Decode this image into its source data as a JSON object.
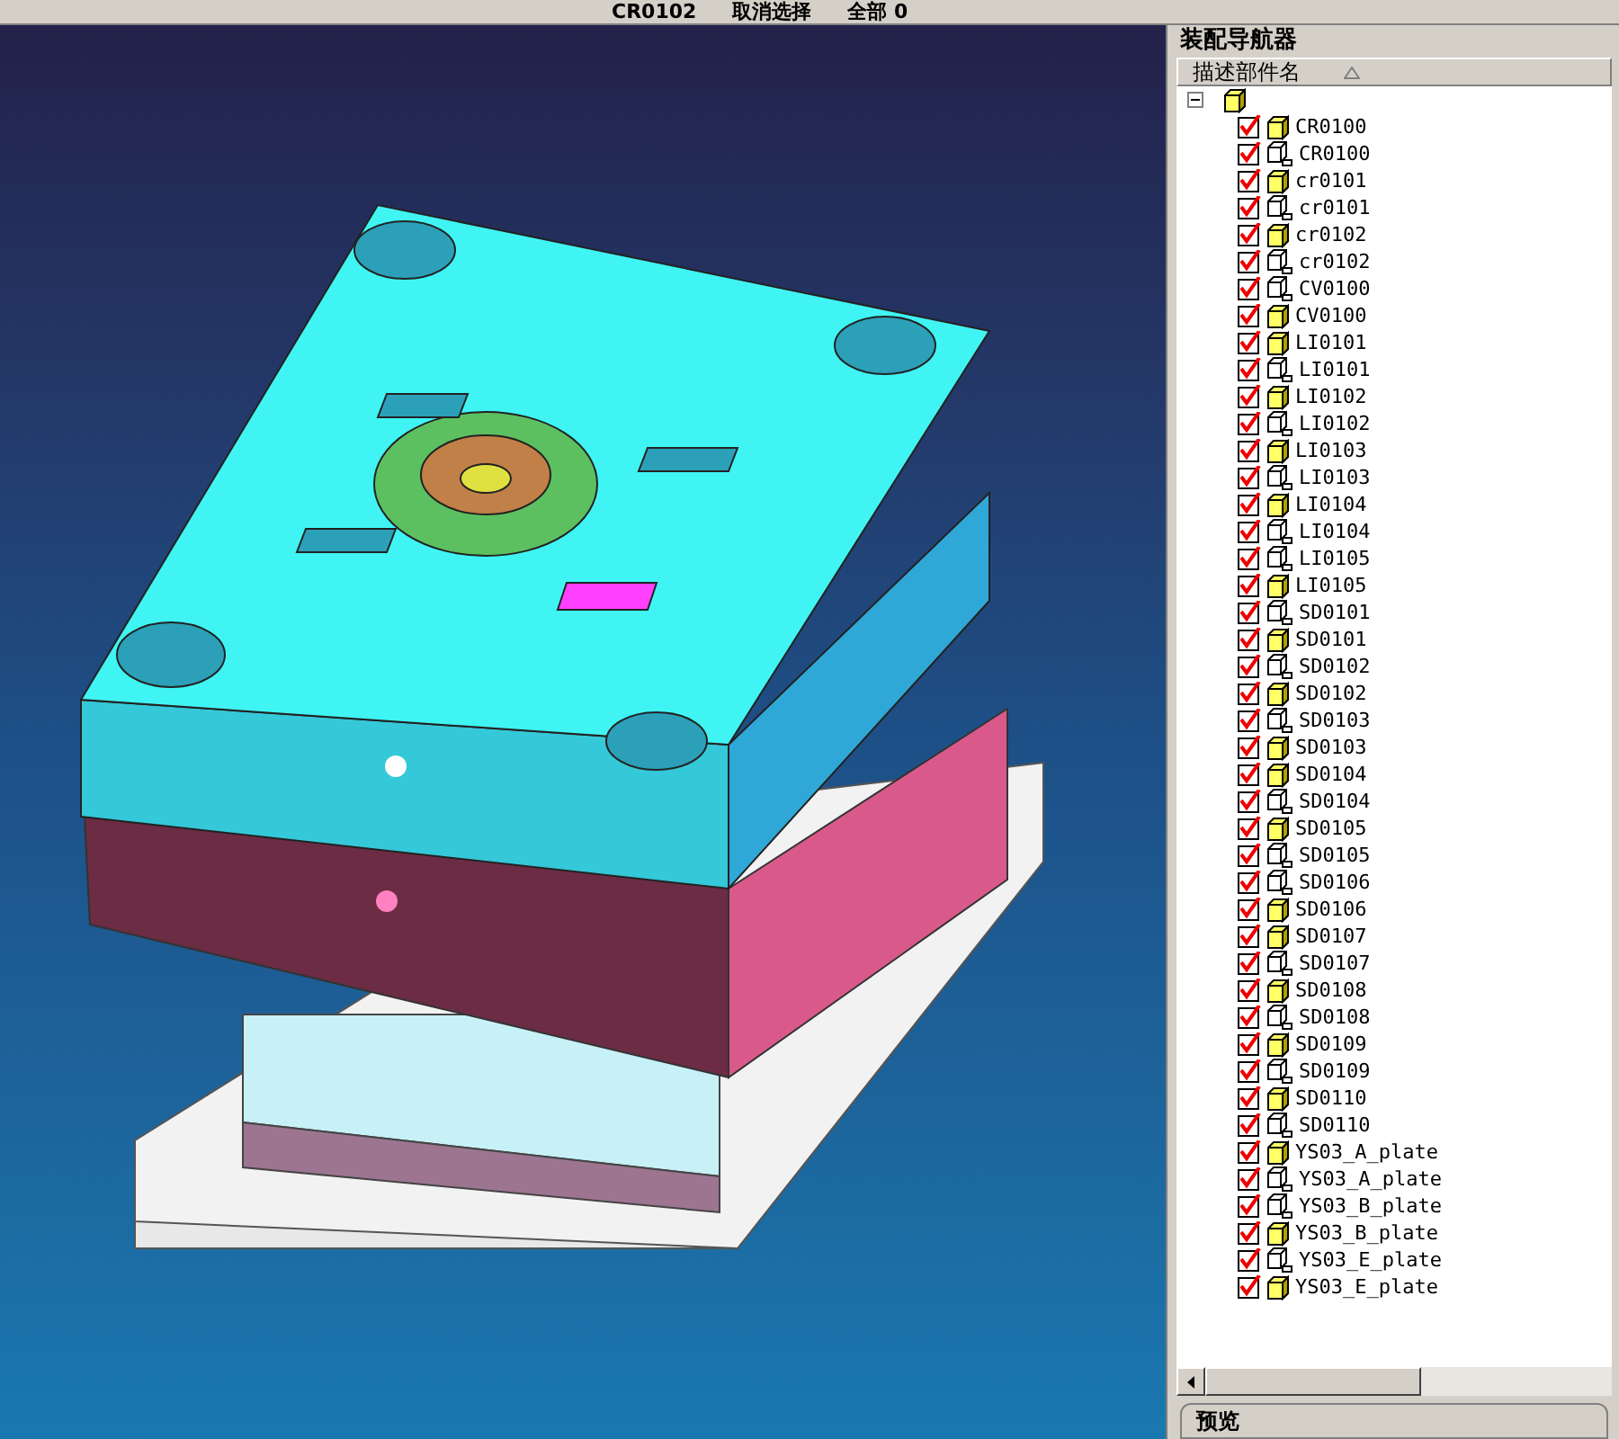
{
  "toolbar": {
    "items": [
      "CR0102",
      "取消选择",
      "全部 0"
    ]
  },
  "navigator": {
    "title": "装配导航器",
    "column": "描述部件名",
    "root": {
      "expanded": true
    },
    "items": [
      {
        "name": "CR0100",
        "checked": true,
        "kind": "solid"
      },
      {
        "name": "CR0100",
        "checked": true,
        "kind": "reference"
      },
      {
        "name": "cr0101",
        "checked": true,
        "kind": "solid"
      },
      {
        "name": "cr0101",
        "checked": true,
        "kind": "reference"
      },
      {
        "name": "cr0102",
        "checked": true,
        "kind": "solid"
      },
      {
        "name": "cr0102",
        "checked": true,
        "kind": "reference"
      },
      {
        "name": "CV0100",
        "checked": true,
        "kind": "reference"
      },
      {
        "name": "CV0100",
        "checked": true,
        "kind": "solid"
      },
      {
        "name": "LI0101",
        "checked": true,
        "kind": "solid"
      },
      {
        "name": "LI0101",
        "checked": true,
        "kind": "reference"
      },
      {
        "name": "LI0102",
        "checked": true,
        "kind": "solid"
      },
      {
        "name": "LI0102",
        "checked": true,
        "kind": "reference"
      },
      {
        "name": "LI0103",
        "checked": true,
        "kind": "solid"
      },
      {
        "name": "LI0103",
        "checked": true,
        "kind": "reference"
      },
      {
        "name": "LI0104",
        "checked": true,
        "kind": "solid"
      },
      {
        "name": "LI0104",
        "checked": true,
        "kind": "reference"
      },
      {
        "name": "LI0105",
        "checked": true,
        "kind": "reference"
      },
      {
        "name": "LI0105",
        "checked": true,
        "kind": "solid"
      },
      {
        "name": "SD0101",
        "checked": true,
        "kind": "reference"
      },
      {
        "name": "SD0101",
        "checked": true,
        "kind": "solid"
      },
      {
        "name": "SD0102",
        "checked": true,
        "kind": "reference"
      },
      {
        "name": "SD0102",
        "checked": true,
        "kind": "solid"
      },
      {
        "name": "SD0103",
        "checked": true,
        "kind": "reference"
      },
      {
        "name": "SD0103",
        "checked": true,
        "kind": "solid"
      },
      {
        "name": "SD0104",
        "checked": true,
        "kind": "solid"
      },
      {
        "name": "SD0104",
        "checked": true,
        "kind": "reference"
      },
      {
        "name": "SD0105",
        "checked": true,
        "kind": "solid"
      },
      {
        "name": "SD0105",
        "checked": true,
        "kind": "reference"
      },
      {
        "name": "SD0106",
        "checked": true,
        "kind": "reference"
      },
      {
        "name": "SD0106",
        "checked": true,
        "kind": "solid"
      },
      {
        "name": "SD0107",
        "checked": true,
        "kind": "solid"
      },
      {
        "name": "SD0107",
        "checked": true,
        "kind": "reference"
      },
      {
        "name": "SD0108",
        "checked": true,
        "kind": "solid"
      },
      {
        "name": "SD0108",
        "checked": true,
        "kind": "reference"
      },
      {
        "name": "SD0109",
        "checked": true,
        "kind": "solid"
      },
      {
        "name": "SD0109",
        "checked": true,
        "kind": "reference"
      },
      {
        "name": "SD0110",
        "checked": true,
        "kind": "solid"
      },
      {
        "name": "SD0110",
        "checked": true,
        "kind": "reference"
      },
      {
        "name": "YS03_A_plate",
        "checked": true,
        "kind": "solid"
      },
      {
        "name": "YS03_A_plate",
        "checked": true,
        "kind": "reference"
      },
      {
        "name": "YS03_B_plate",
        "checked": true,
        "kind": "reference"
      },
      {
        "name": "YS03_B_plate",
        "checked": true,
        "kind": "solid"
      },
      {
        "name": "YS03_E_plate",
        "checked": true,
        "kind": "reference"
      },
      {
        "name": "YS03_E_plate",
        "checked": true,
        "kind": "solid"
      }
    ]
  },
  "preview_tab": {
    "label": "预览"
  }
}
